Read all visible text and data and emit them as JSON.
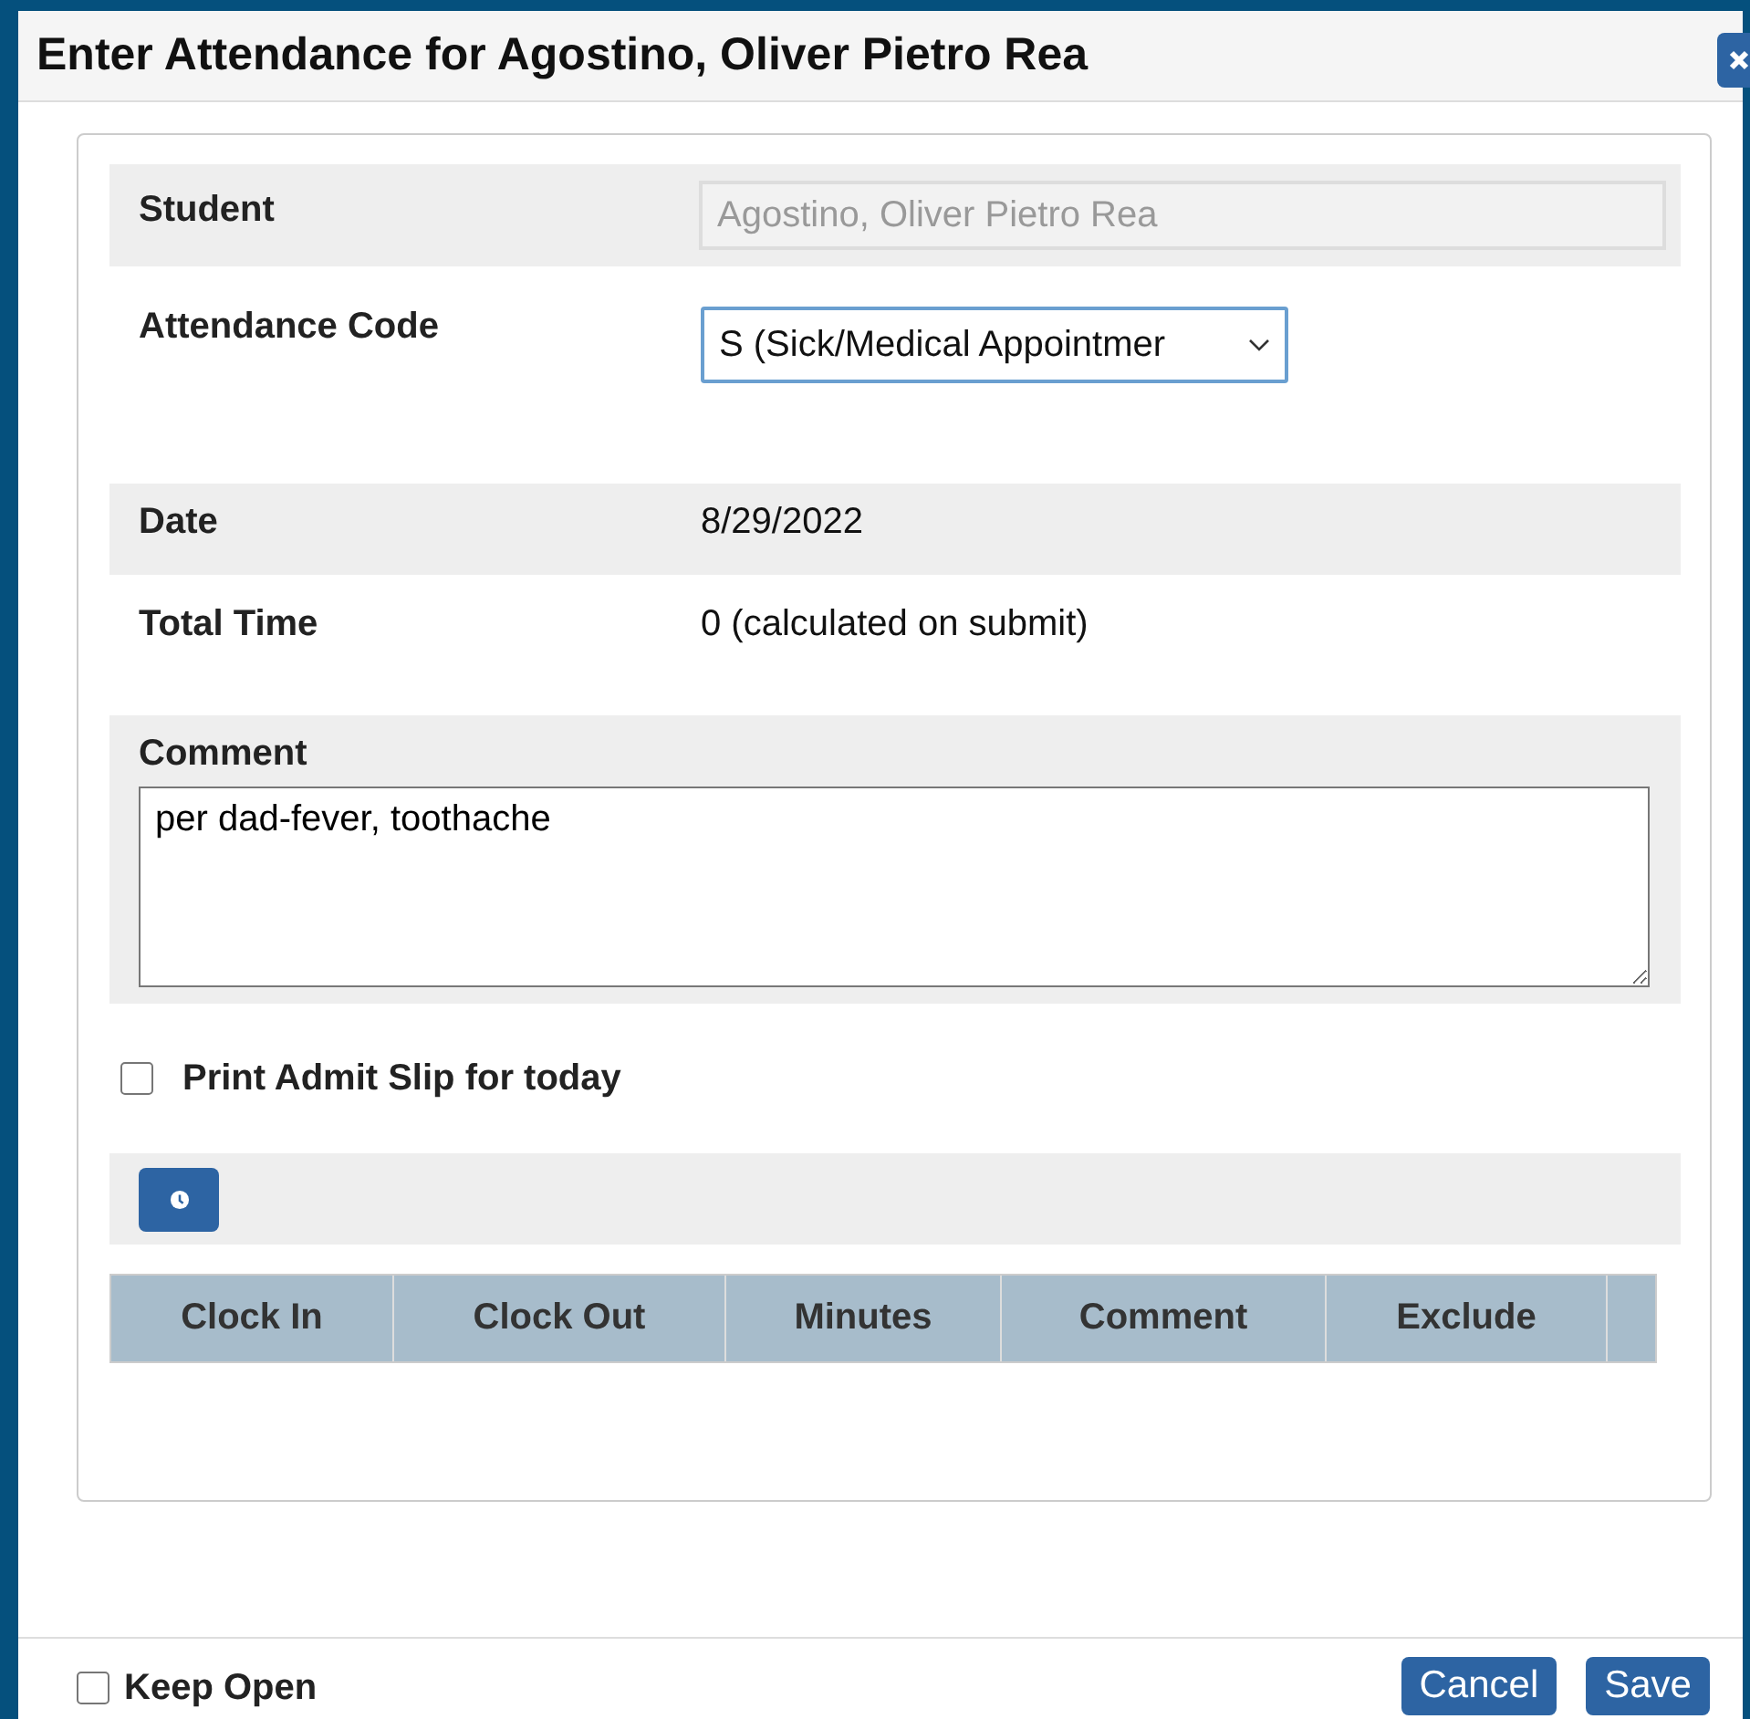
{
  "dialog": {
    "title": "Enter Attendance for Agostino, Oliver Pietro Rea"
  },
  "fields": [
    {
      "kind": "readonly",
      "label": "Student",
      "value": "Agostino, Oliver Pietro Rea",
      "shaded": true
    },
    {
      "kind": "select",
      "label": "Attendance Code",
      "value": "S (Sick/Medical Appointmer",
      "shaded": false
    },
    {
      "kind": "text",
      "label": "Date",
      "value": "8/29/2022",
      "shaded": true
    },
    {
      "kind": "text",
      "label": "Total Time",
      "value": "0 (calculated on submit)",
      "shaded": false
    }
  ],
  "comment": {
    "label": "Comment",
    "value": "per dad-fever, toothache"
  },
  "admit_slip": {
    "label": "Print Admit Slip for today",
    "checked": false
  },
  "time_table": {
    "columns": [
      "Clock In",
      "Clock Out",
      "Minutes",
      "Comment",
      "Exclude"
    ]
  },
  "footer": {
    "keep_open": {
      "label": "Keep Open",
      "checked": false
    },
    "buttons": [
      "Cancel",
      "Save"
    ]
  }
}
